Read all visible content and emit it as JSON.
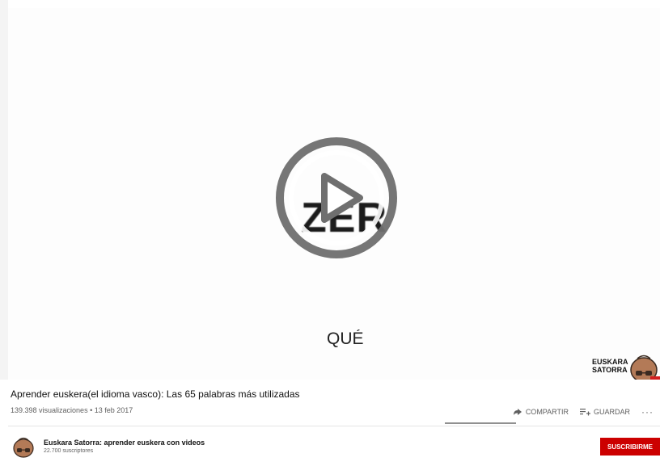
{
  "video": {
    "word_main": "ZER",
    "word_sub": "QUÉ",
    "brand_line1": "EUSKARA",
    "brand_line2": "SATORRA",
    "play_icon": "play-circle-icon"
  },
  "info": {
    "title": "Aprender euskera(el idioma vasco): Las 65 palabras más utilizadas",
    "meta": "139.398 visualizaciones • 13 feb 2017"
  },
  "actions": {
    "share": "COMPARTIR",
    "save": "GUARDAR",
    "more": "···"
  },
  "channel": {
    "name": "Euskara Satorra: aprender euskera con videos",
    "subscribers": "22.700 suscriptores",
    "subscribe": "SUSCRIBIRME"
  },
  "colors": {
    "subscribe_bg": "#cc0000",
    "play_overlay": "#6f6f6f"
  }
}
